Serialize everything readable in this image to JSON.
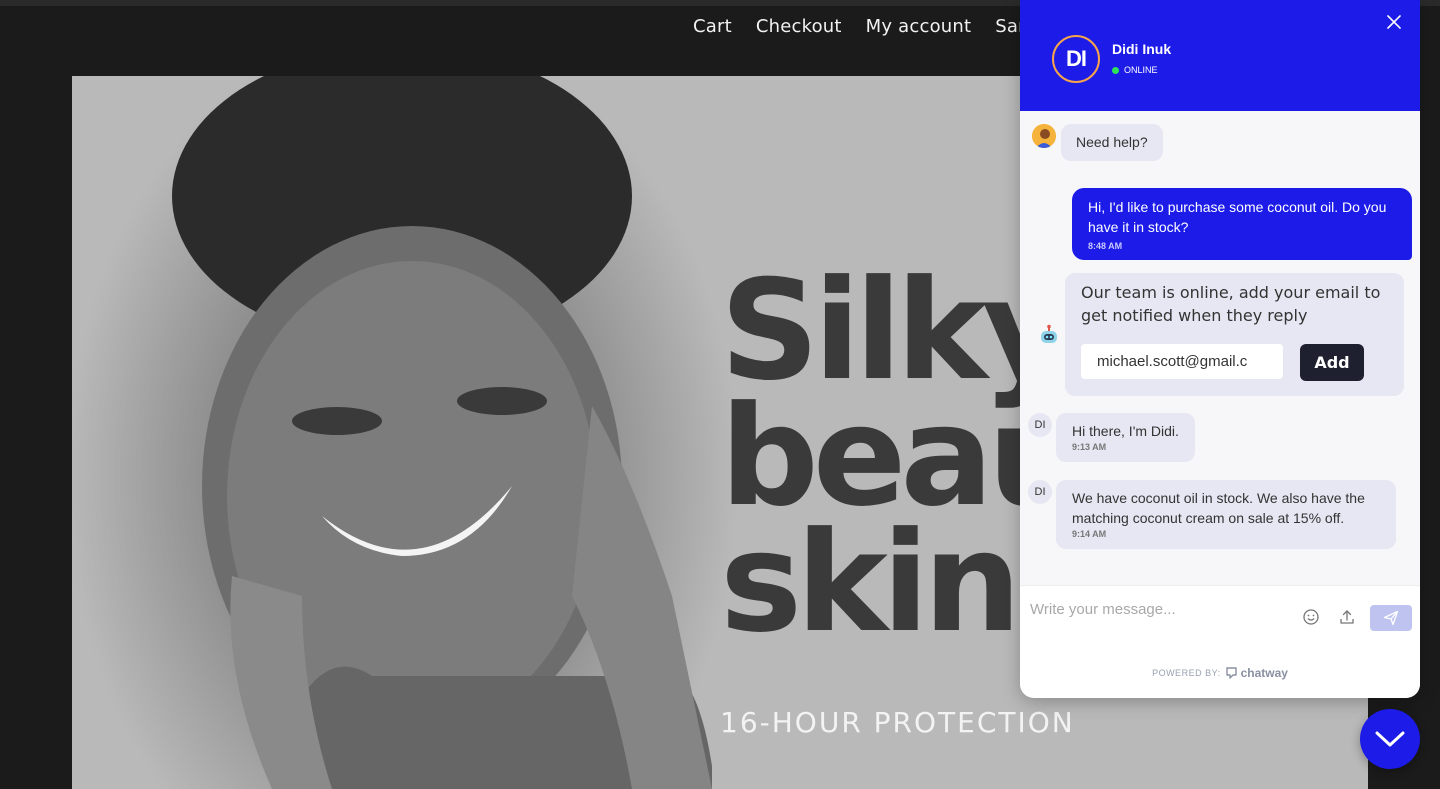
{
  "nav": {
    "items": [
      "Cart",
      "Checkout",
      "My account",
      "Sam"
    ]
  },
  "hero": {
    "headline_lines": [
      "Silky",
      "beau",
      "skin."
    ],
    "tagline": "16-HOUR PROTECTION"
  },
  "chat": {
    "agent": {
      "initials": "DI",
      "name": "Didi Inuk",
      "status": "ONLINE"
    },
    "messages": {
      "need_help": "Need help?",
      "outgoing": {
        "text": "Hi, I'd like to purchase some coconut oil. Do you have it in stock?",
        "time": "8:48 AM"
      },
      "bot_card": {
        "text": "Our team is online, add your email to get notified when they reply",
        "email_value": "michael.scott@gmail.c",
        "add_label": "Add"
      },
      "incoming_1": {
        "avatar": "DI",
        "text": "Hi there, I'm Didi.",
        "time": "9:13 AM"
      },
      "incoming_2": {
        "avatar": "DI",
        "text": "We have coconut oil in stock. We also have the matching coconut cream on sale at 15% off.",
        "time": "9:14 AM"
      }
    },
    "composer": {
      "placeholder": "Write your message..."
    },
    "footer": {
      "powered_by": "POWERED BY:",
      "brand": "chatway"
    }
  },
  "colors": {
    "brand": "#1c1be8",
    "online": "#2ee35a",
    "bubble": "#e7e7f3",
    "avatar_ring": "#f6a44a"
  },
  "icons": [
    "close-icon",
    "emoji-icon",
    "upload-icon",
    "send-icon",
    "chevron-down-icon",
    "robot-icon",
    "chatway-logo-icon"
  ]
}
